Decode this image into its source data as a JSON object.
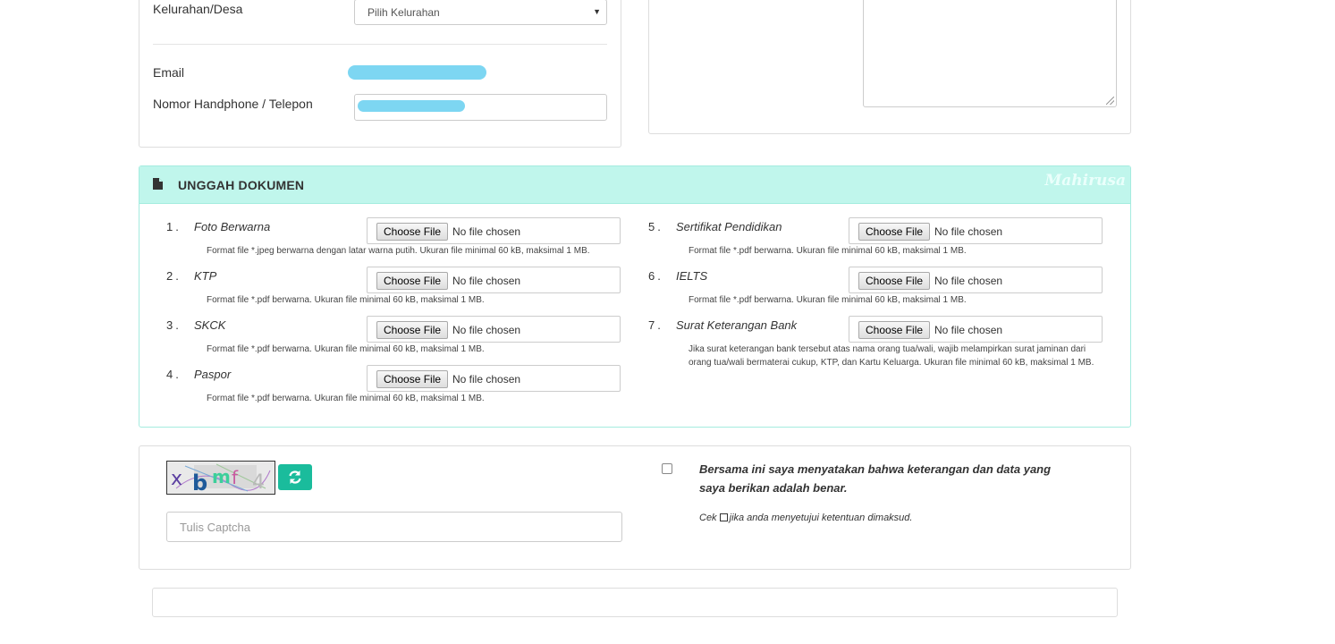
{
  "personal": {
    "kelurahan_label": "Kelurahan/Desa",
    "kelurahan_value": "Pilih Kelurahan",
    "email_label": "Email",
    "phone_label": "Nomor Handphone / Telepon"
  },
  "upload": {
    "title": "UNGGAH DOKUMEN",
    "watermark": "Mahirusa",
    "choose_label": "Choose File",
    "no_file": "No file chosen",
    "docs": [
      {
        "num": "1.",
        "name": "Foto Berwarna",
        "hint": "Format file *.jpeg berwarna dengan latar warna putih. Ukuran file minimal 60 kB, maksimal 1 MB."
      },
      {
        "num": "2.",
        "name": "KTP",
        "hint": "Format file *.pdf berwarna. Ukuran file minimal 60 kB, maksimal 1 MB."
      },
      {
        "num": "3.",
        "name": "SKCK",
        "hint": "Format file *.pdf berwarna. Ukuran file minimal 60 kB, maksimal 1 MB."
      },
      {
        "num": "4.",
        "name": "Paspor",
        "hint": "Format file *.pdf berwarna. Ukuran file minimal 60 kB, maksimal 1 MB."
      },
      {
        "num": "5.",
        "name": "Sertifikat Pendidikan",
        "hint": "Format file *.pdf berwarna. Ukuran file minimal 60 kB, maksimal 1 MB."
      },
      {
        "num": "6.",
        "name": "IELTS",
        "hint": "Format file *.pdf berwarna. Ukuran file minimal 60 kB, maksimal 1 MB."
      },
      {
        "num": "7.",
        "name": "Surat Keterangan Bank",
        "hint": "Jika surat keterangan bank tersebut atas nama orang tua/wali, wajib melampirkan surat jaminan dari orang tua/wali bermaterai cukup, KTP, dan Kartu Keluarga. Ukuran file minimal 60 kB, maksimal 1 MB."
      }
    ]
  },
  "captcha": {
    "text": "xbmf4",
    "placeholder": "Tulis Captcha",
    "declaration": "Bersama ini saya menyatakan bahwa keterangan dan data yang saya berikan adalah benar.",
    "note_before": "Cek",
    "note_after": "jika anda menyetujui ketentuan dimaksud."
  },
  "colors": {
    "upload_header": "#c0f6ec",
    "refresh_button": "#1abc9c",
    "redaction": "#7dd6f2"
  }
}
